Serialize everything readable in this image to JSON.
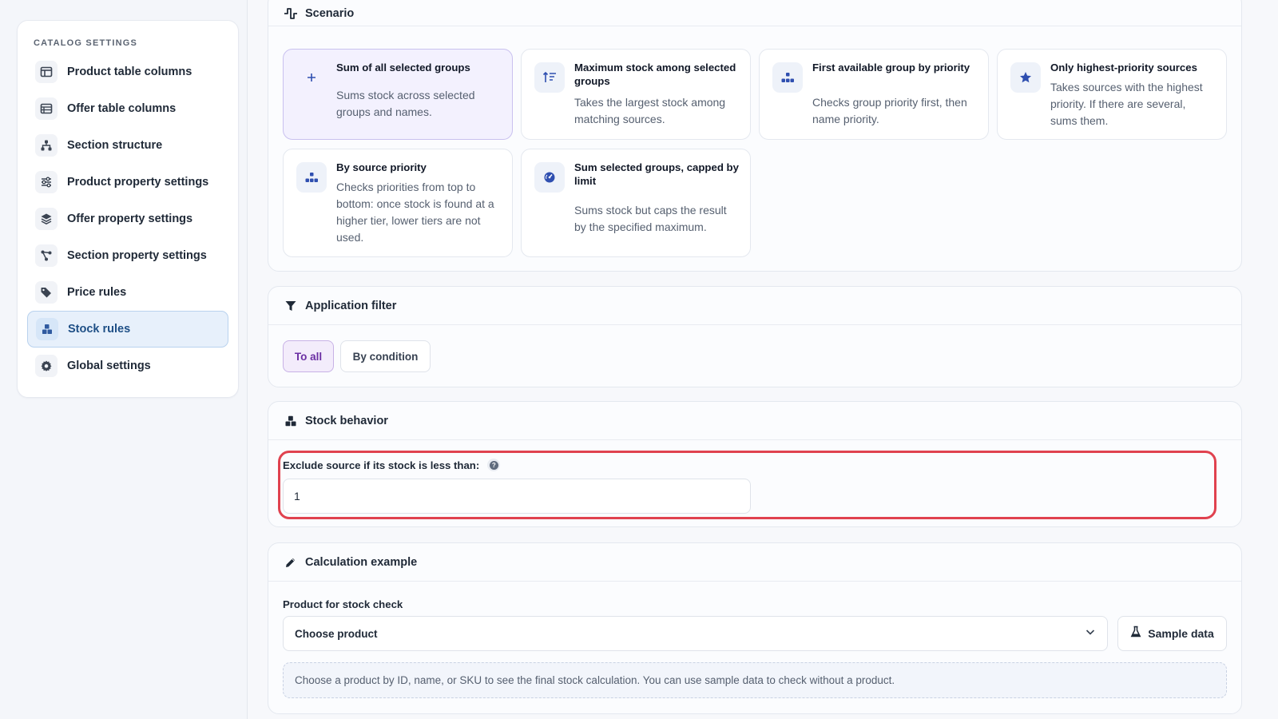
{
  "sidebar": {
    "heading": "CATALOG SETTINGS",
    "items": [
      {
        "label": "Product table columns",
        "icon": "columns-icon"
      },
      {
        "label": "Offer table columns",
        "icon": "table-icon"
      },
      {
        "label": "Section structure",
        "icon": "hierarchy-icon"
      },
      {
        "label": "Product property settings",
        "icon": "sliders-icon"
      },
      {
        "label": "Offer property settings",
        "icon": "layers-icon"
      },
      {
        "label": "Section property settings",
        "icon": "share-nodes-icon"
      },
      {
        "label": "Price rules",
        "icon": "tags-icon"
      },
      {
        "label": "Stock rules",
        "icon": "boxes-icon",
        "active": true
      },
      {
        "label": "Global settings",
        "icon": "gear-icon"
      }
    ]
  },
  "scenario": {
    "title": "Scenario",
    "cards": [
      {
        "title": "Sum of all selected groups",
        "desc": "Sums stock across selected groups and names.",
        "icon": "plus-icon",
        "selected": true
      },
      {
        "title": "Maximum stock among selected groups",
        "desc": "Takes the largest stock among matching sources.",
        "icon": "sort-desc-icon"
      },
      {
        "title": "First available group by priority",
        "desc": "Checks group priority first, then name priority.",
        "icon": "hierarchy-icon"
      },
      {
        "title": "Only highest-priority sources",
        "desc": "Takes sources with the highest priority. If there are several, sums them.",
        "icon": "star-icon"
      },
      {
        "title": "By source priority",
        "desc": "Checks priorities from top to bottom: once stock is found at a higher tier, lower tiers are not used.",
        "icon": "hierarchy-icon"
      },
      {
        "title": "Sum selected groups, capped by limit",
        "desc": "Sums stock but caps the result by the specified maximum.",
        "icon": "gauge-icon"
      }
    ]
  },
  "filter": {
    "title": "Application filter",
    "options": [
      "To all",
      "By condition"
    ],
    "selected": "To all"
  },
  "stock_behavior": {
    "title": "Stock behavior",
    "field_label": "Exclude source if its stock is less than:",
    "field_value": "1"
  },
  "calculation": {
    "title": "Calculation example",
    "product_label": "Product for stock check",
    "select_value": "Choose product",
    "sample_button": "Sample data",
    "hint": "Choose a product by ID, name, or SKU to see the final stock calculation. You can use sample data to check without a product."
  },
  "colors": {
    "accent": "#2f4fb0",
    "active_nav_bg": "#e7f0fb",
    "highlight_border": "#e0424f",
    "selected_card_bg": "#f3f1fe",
    "filter_active_text": "#6b2fa3"
  }
}
